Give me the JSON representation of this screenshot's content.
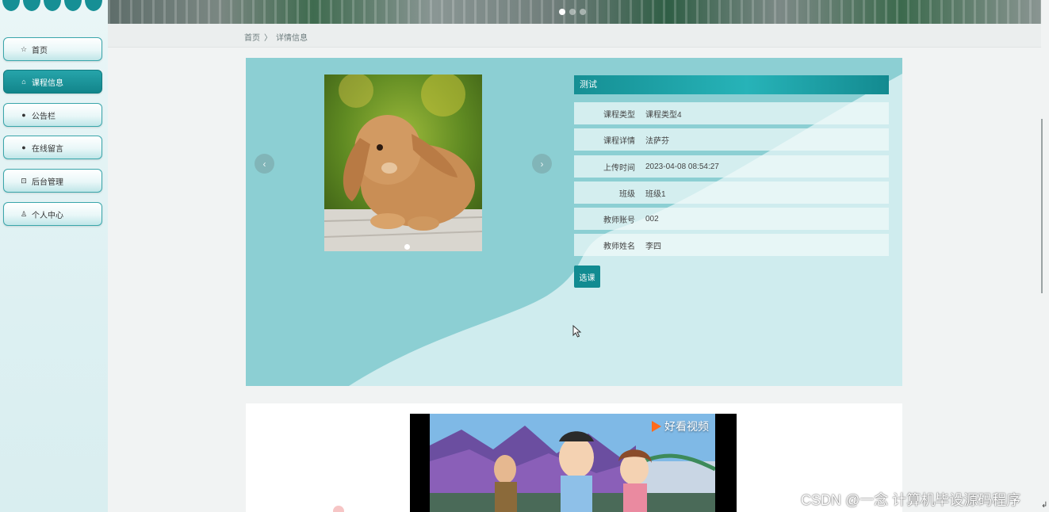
{
  "sidebar": {
    "items": [
      {
        "label": "首页",
        "icon": "star-icon",
        "glyph": "☆"
      },
      {
        "label": "课程信息",
        "icon": "home-icon",
        "glyph": "⌂"
      },
      {
        "label": "公告栏",
        "icon": "bullet-icon",
        "glyph": "●"
      },
      {
        "label": "在线留言",
        "icon": "question-icon",
        "glyph": "●"
      },
      {
        "label": "后台管理",
        "icon": "panel-icon",
        "glyph": "⊡"
      },
      {
        "label": "个人中心",
        "icon": "user-icon",
        "glyph": "♙"
      }
    ],
    "active_index": 1,
    "accent": "#158f94"
  },
  "breadcrumb": {
    "home": "首页",
    "separator": "〉",
    "current": "详情信息"
  },
  "detail": {
    "title": "测试",
    "fields": [
      {
        "label": "课程类型",
        "value": "课程类型4"
      },
      {
        "label": "课程详情",
        "value": "法萨芬"
      },
      {
        "label": "上传时间",
        "value": "2023-04-08 08:54:27"
      },
      {
        "label": "班级",
        "value": "班级1"
      },
      {
        "label": "教师账号",
        "value": "002"
      },
      {
        "label": "教师姓名",
        "value": "李四"
      }
    ],
    "select_button": "选课",
    "prev_arrow": "‹",
    "next_arrow": "›"
  },
  "video": {
    "brand": "好看视频"
  },
  "watermark": "CSDN @一念 计算机毕设源码程序",
  "colors": {
    "panel": "#8ccfd3",
    "title_bar": "#158f94",
    "button": "#118b91"
  }
}
